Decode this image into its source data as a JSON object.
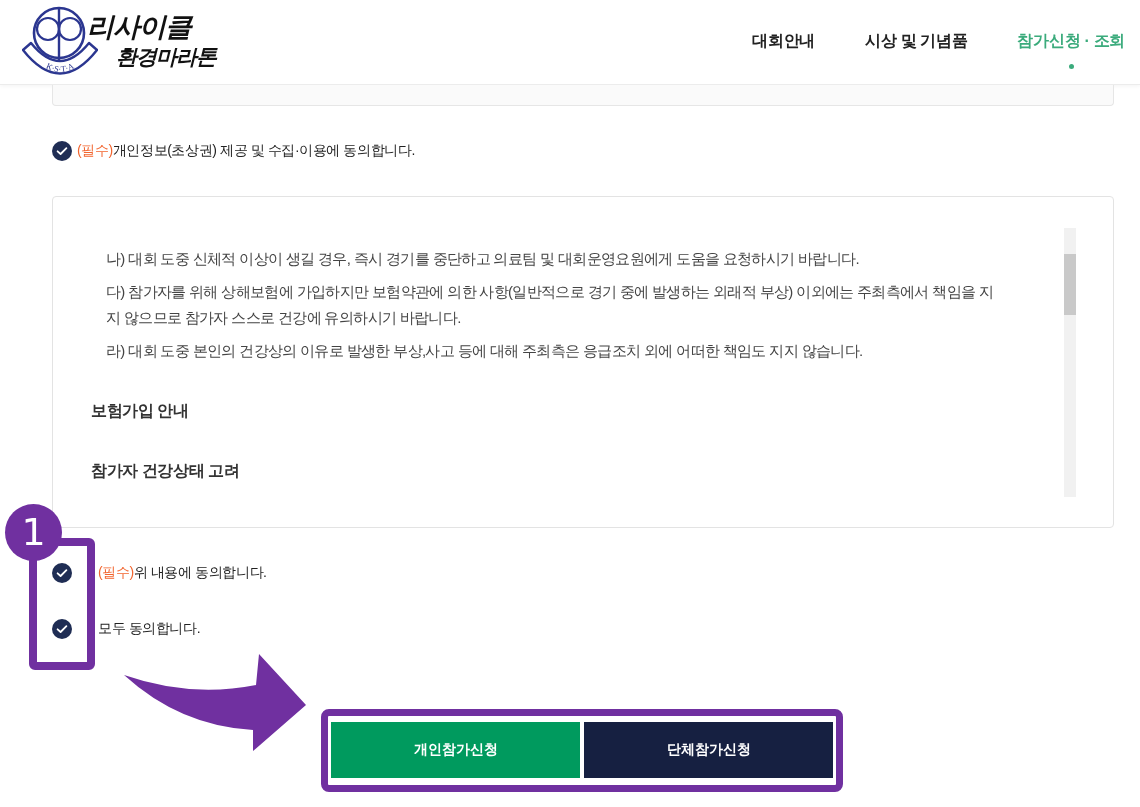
{
  "header": {
    "logo": {
      "emblem_text": "K·S·T·A",
      "title": "리사이클",
      "subtitle": "환경마라톤"
    },
    "nav": [
      {
        "label": "대회안내",
        "selected": false
      },
      {
        "label": "시상 및 기념품",
        "selected": false
      },
      {
        "label": "참가신청 · 조회",
        "selected": true
      }
    ]
  },
  "privacy_consent": {
    "tag": "(필수)",
    "text": "개인정보(초상권) 제공 및 수집·이용에 동의합니다.",
    "checked": true
  },
  "terms_box": {
    "lines": [
      {
        "kind": "item",
        "text": "나) 대회 도중 신체적 이상이 생길 경우, 즉시 경기를 중단하고 의료팀 및 대회운영요원에게 도움을 요청하시기 바랍니다."
      },
      {
        "kind": "item",
        "text": "다) 참가자를 위해 상해보험에 가입하지만 보험약관에 의한 사항(일반적으로 경기 중에 발생하는 외래적 부상) 이외에는 주최측에서 책임을 지지 않으므로 참가자 스스로 건강에 유의하시기 바랍니다."
      },
      {
        "kind": "item",
        "text": "라) 대회 도중 본인의 건강상의 이유로 발생한 부상,사고 등에 대해 주최측은 응급조치 외에 어떠한 책임도 지지 않습니다."
      },
      {
        "kind": "heading",
        "text": "보험가입 안내"
      },
      {
        "kind": "heading",
        "text": "참가자 건강상태 고려"
      }
    ]
  },
  "consents": [
    {
      "tag": "(필수)",
      "text": "위 내용에 동의합니다.",
      "checked": true
    },
    {
      "text": "모두 동의합니다.",
      "checked": true
    }
  ],
  "buttons": [
    {
      "label": "개인참가신청",
      "kind": "primary"
    },
    {
      "label": "단체참가신청",
      "kind": "secondary"
    }
  ],
  "callout": {
    "number": "1"
  }
}
